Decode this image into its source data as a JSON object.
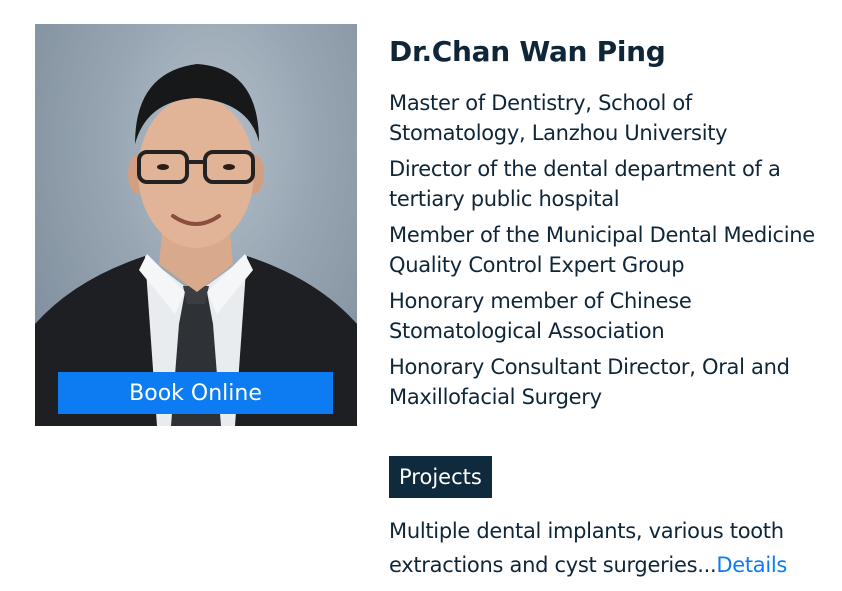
{
  "doctor": {
    "name": "Dr.Chan Wan Ping",
    "photo_icon": "doctor-portrait-photo",
    "credentials": [
      "Master of Dentistry, School of Stomatology, Lanzhou University",
      "Director of the dental department of a tertiary public hospital",
      "Member of the Municipal Dental Medicine Quality Control Expert Group",
      "Honorary member of Chinese Stomatological Association",
      "Honorary Consultant Director, Oral and Maxillofacial Surgery"
    ]
  },
  "actions": {
    "book_label": "Book Online"
  },
  "projects": {
    "tag_label": "Projects",
    "description": "Multiple dental implants, various tooth extractions and cyst surgeries...",
    "details_label": "Details"
  },
  "colors": {
    "accent": "#0d7cf2",
    "dark": "#0f2a3d",
    "text": "#0f2638"
  }
}
